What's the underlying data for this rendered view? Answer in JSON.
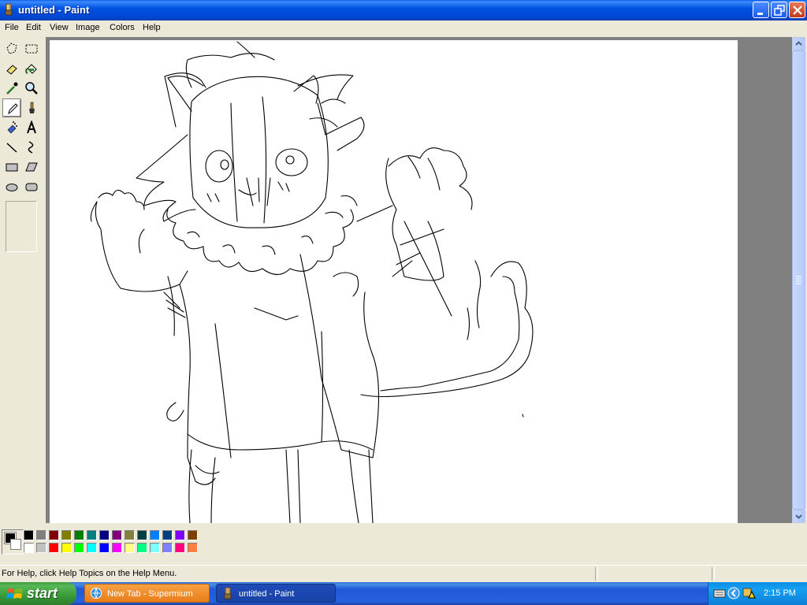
{
  "window": {
    "title": "untitled - Paint",
    "icon": "paint-app-icon",
    "controls": [
      "minimize-icon",
      "maximize-icon",
      "close-icon"
    ]
  },
  "menu": {
    "items": [
      "File",
      "Edit",
      "View",
      "Image",
      "Colors",
      "Help"
    ]
  },
  "toolbox": {
    "tools": [
      "free-form-select-icon",
      "select-icon",
      "eraser-icon",
      "fill-icon",
      "pick-color-icon",
      "magnifier-icon",
      "pencil-icon",
      "brush-icon",
      "airbrush-icon",
      "text-icon",
      "line-icon",
      "curve-icon",
      "rectangle-icon",
      "polygon-icon",
      "ellipse-icon",
      "rounded-rectangle-icon"
    ],
    "selected_tool": "pencil-icon"
  },
  "palette": {
    "foreground": "#000000",
    "background": "#ffffff",
    "row1": [
      "#000000",
      "#808080",
      "#800000",
      "#808000",
      "#008000",
      "#008080",
      "#000080",
      "#800080",
      "#808040",
      "#004040",
      "#0080ff",
      "#004080",
      "#8000ff",
      "#804000"
    ],
    "row2": [
      "#ffffff",
      "#c0c0c0",
      "#ff0000",
      "#ffff00",
      "#00ff00",
      "#00ffff",
      "#0000ff",
      "#ff00ff",
      "#ffff80",
      "#00ff80",
      "#80ffff",
      "#8080ff",
      "#ff0080",
      "#ff8040"
    ]
  },
  "status": {
    "help_text": "For Help, click Help Topics on the Help Menu."
  },
  "taskbar": {
    "start_label": "start",
    "tasks": [
      {
        "label": "New Tab - Supermium",
        "icon": "browser-icon"
      },
      {
        "label": "untitled - Paint",
        "icon": "paint-app-icon"
      }
    ],
    "clock": "2:15 PM"
  }
}
